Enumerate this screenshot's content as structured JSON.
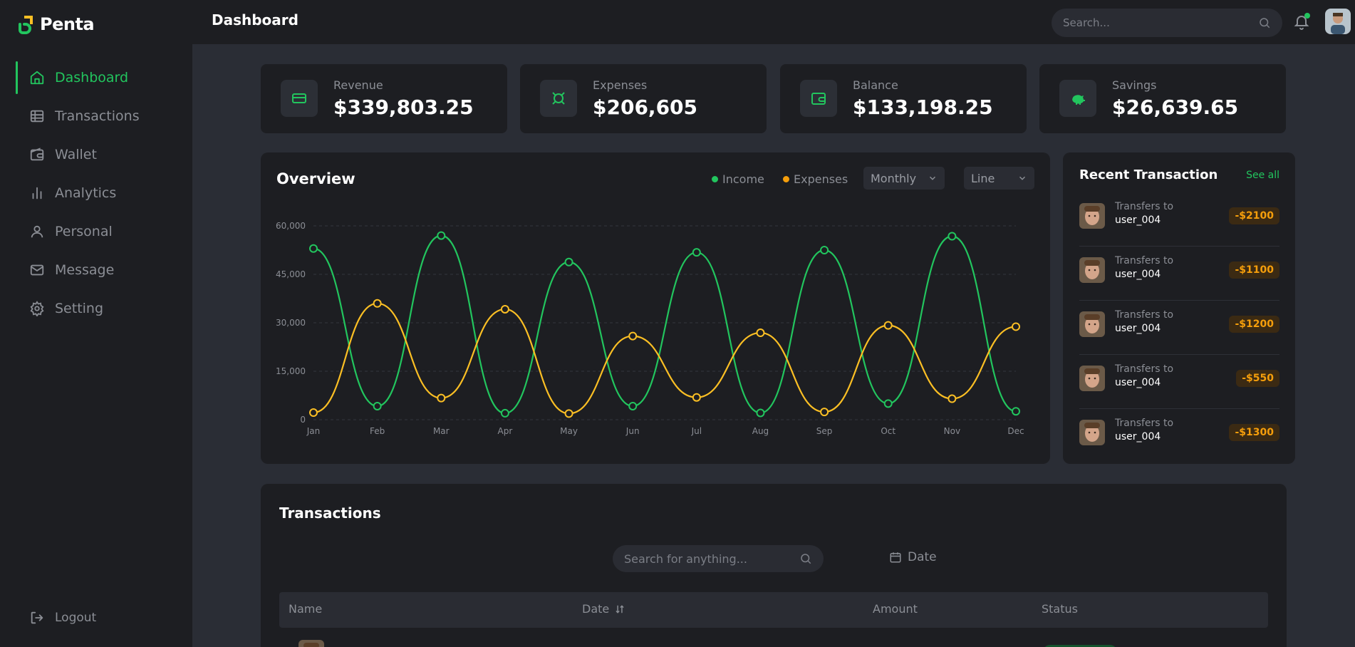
{
  "app": {
    "name": "Penta"
  },
  "header": {
    "title": "Dashboard",
    "search_placeholder": "Search..."
  },
  "sidebar": {
    "items": [
      {
        "label": "Dashboard",
        "icon": "home-icon",
        "active": true
      },
      {
        "label": "Transactions",
        "icon": "table-icon",
        "active": false
      },
      {
        "label": "Wallet",
        "icon": "wallet-icon",
        "active": false
      },
      {
        "label": "Analytics",
        "icon": "bar-chart-icon",
        "active": false
      },
      {
        "label": "Personal",
        "icon": "user-icon",
        "active": false
      },
      {
        "label": "Message",
        "icon": "mail-icon",
        "active": false
      },
      {
        "label": "Setting",
        "icon": "gear-icon",
        "active": false
      }
    ],
    "logout_label": "Logout"
  },
  "stats": [
    {
      "label": "Revenue",
      "value": "$339,803.25",
      "icon": "credit-card-icon"
    },
    {
      "label": "Expenses",
      "value": "$206,605",
      "icon": "currency-icon"
    },
    {
      "label": "Balance",
      "value": "$133,198.25",
      "icon": "wallet-icon"
    },
    {
      "label": "Savings",
      "value": "$26,639.65",
      "icon": "piggy-bank-icon"
    }
  ],
  "overview": {
    "title": "Overview",
    "legend": [
      "Income",
      "Expenses"
    ],
    "period_select": "Monthly",
    "type_select": "Line"
  },
  "chart_data": {
    "type": "line",
    "categories": [
      "Jan",
      "Feb",
      "Mar",
      "Apr",
      "May",
      "Jun",
      "Jul",
      "Aug",
      "Sep",
      "Oct",
      "Nov",
      "Dec"
    ],
    "series": [
      {
        "name": "Income",
        "values": [
          53000,
          4200,
          57000,
          2000,
          48800,
          4200,
          51800,
          2100,
          52500,
          5000,
          56800,
          2600
        ]
      },
      {
        "name": "Expenses",
        "values": [
          2200,
          36000,
          6700,
          34200,
          1900,
          25900,
          6900,
          26900,
          2400,
          29200,
          6500,
          28800
        ]
      }
    ],
    "yticks": [
      "0",
      "15,000",
      "30,000",
      "45,000",
      "60,000"
    ],
    "ylim": [
      0,
      60000
    ],
    "grid": true,
    "colors": {
      "Income": "#22c55e",
      "Expenses": "#fbbf24"
    }
  },
  "recent": {
    "title": "Recent Transaction",
    "see_all": "See all",
    "items": [
      {
        "line1": "Transfers to",
        "line2": "user_004",
        "amount": "-$2100"
      },
      {
        "line1": "Transfers to",
        "line2": "user_004",
        "amount": "-$1100"
      },
      {
        "line1": "Transfers to",
        "line2": "user_004",
        "amount": "-$1200"
      },
      {
        "line1": "Transfers to",
        "line2": "user_004",
        "amount": "-$550"
      },
      {
        "line1": "Transfers to",
        "line2": "user_004",
        "amount": "-$1300"
      }
    ]
  },
  "transactions": {
    "title": "Transactions",
    "search_placeholder": "Search for anything...",
    "date_filter": "Date",
    "columns": [
      "Name",
      "Date",
      "Amount",
      "Status"
    ]
  }
}
